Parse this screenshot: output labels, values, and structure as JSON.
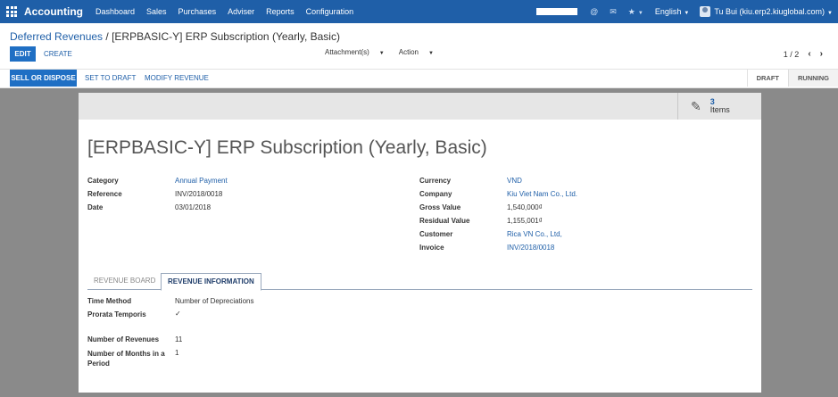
{
  "topbar": {
    "brand": "Accounting",
    "menu": [
      "Dashboard",
      "Sales",
      "Purchases",
      "Adviser",
      "Reports",
      "Configuration"
    ],
    "language": "English",
    "user": "Tu Bui (kiu.erp2.kiuglobal.com)",
    "icons": [
      "apps-grid-icon",
      "at-icon",
      "chat-icon",
      "bug-icon",
      "user-avatar-icon"
    ]
  },
  "breadcrumb": {
    "parent": "Deferred Revenues",
    "separator": "/",
    "current": "[ERPBASIC-Y] ERP Subscription (Yearly, Basic)"
  },
  "control": {
    "edit": "EDIT",
    "create": "CREATE",
    "attachments": "Attachment(s)",
    "action": "Action",
    "pager": "1 / 2"
  },
  "statusbar": {
    "sell_or_dispose": "SELL OR DISPOSE",
    "set_to_draft": "SET TO DRAFT",
    "modify_revenue": "MODIFY REVENUE",
    "stages": [
      "DRAFT",
      "RUNNING"
    ],
    "active_stage": "RUNNING"
  },
  "sheet": {
    "items_count": "3",
    "items_label": "Items",
    "title": "[ERPBASIC-Y] ERP Subscription (Yearly, Basic)",
    "left_fields": [
      {
        "label": "Category",
        "value": "Annual Payment"
      },
      {
        "label": "Reference",
        "value": "INV/2018/0018"
      },
      {
        "label": "Date",
        "value": "03/01/2018"
      }
    ],
    "right_fields": [
      {
        "label": "Currency",
        "value": "VND"
      },
      {
        "label": "Company",
        "value": "Kiu Viet Nam Co., Ltd."
      },
      {
        "label": "Gross Value",
        "value": "1,540,000₫"
      },
      {
        "label": "Residual Value",
        "value": "1,155,001₫"
      },
      {
        "label": "Customer",
        "value": "Rica VN Co., Ltd,"
      },
      {
        "label": "Invoice",
        "value": "INV/2018/0018"
      }
    ],
    "tabs": [
      "REVENUE BOARD",
      "REVENUE INFORMATION"
    ],
    "active_tab": "REVENUE INFORMATION",
    "info_fields": [
      {
        "label": "Time Method",
        "value": "Number of Depreciations"
      },
      {
        "label": "Prorata Temporis",
        "value": "✓"
      },
      {
        "label": "Number of Revenues",
        "value": "11"
      },
      {
        "label": "Number of Months in a Period",
        "value": "1"
      }
    ]
  }
}
